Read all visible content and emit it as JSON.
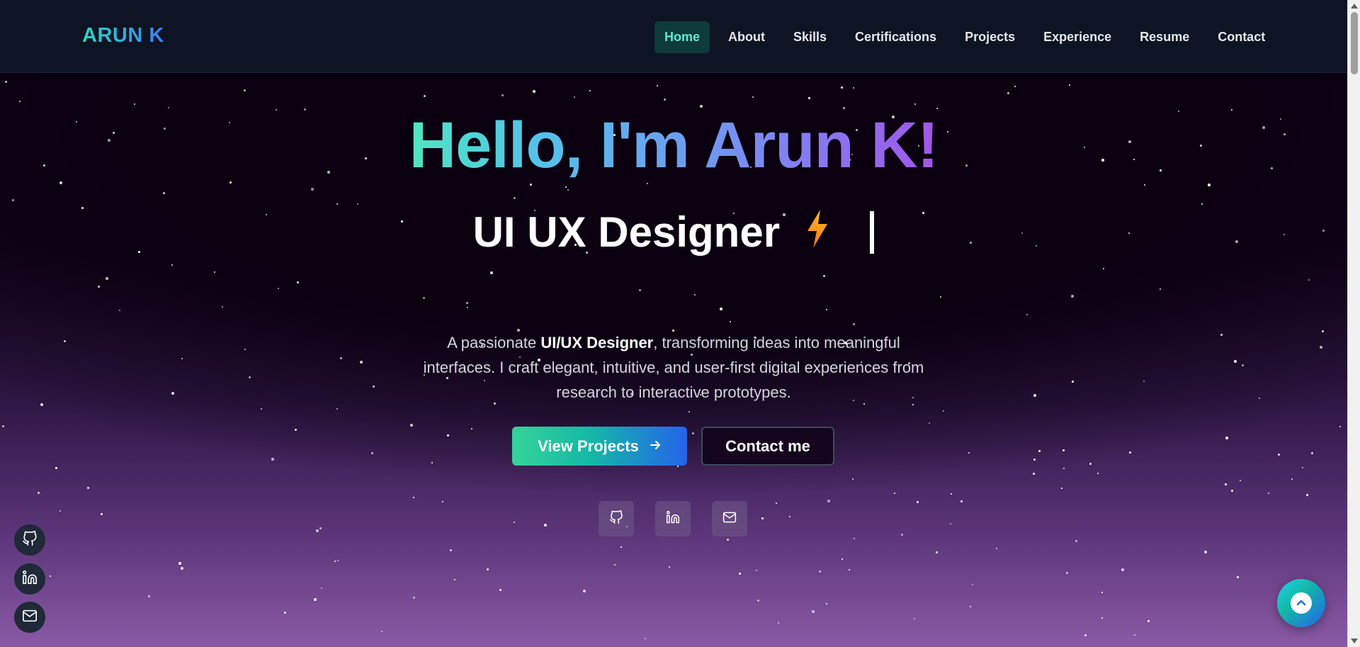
{
  "brand": "ARUN K",
  "nav": {
    "items": [
      {
        "label": "Home",
        "active": true
      },
      {
        "label": "About",
        "active": false
      },
      {
        "label": "Skills",
        "active": false
      },
      {
        "label": "Certifications",
        "active": false
      },
      {
        "label": "Projects",
        "active": false
      },
      {
        "label": "Experience",
        "active": false
      },
      {
        "label": "Resume",
        "active": false
      },
      {
        "label": "Contact",
        "active": false
      }
    ]
  },
  "hero": {
    "title": "Hello, I'm Arun K!",
    "subtitle": "UI UX Designer",
    "subtitle_icon": "lightning-bolt-icon",
    "description": {
      "prefix": "A passionate ",
      "highlight": "UI/UX Designer",
      "suffix": ", transforming ideas into meaningful interfaces. I craft elegant, intuitive, and user-first digital experiences from research to interactive prototypes."
    },
    "primary_button": "View Projects",
    "secondary_button": "Contact me"
  },
  "social_links": [
    "github-icon",
    "linkedin-icon",
    "mail-icon"
  ],
  "colors": {
    "nav_bg": "#0f1424",
    "accent_teal": "#2dd4bf",
    "accent_blue": "#3b82f6",
    "accent_purple": "#a855f7",
    "active_nav_bg": "#0d3a3a"
  }
}
